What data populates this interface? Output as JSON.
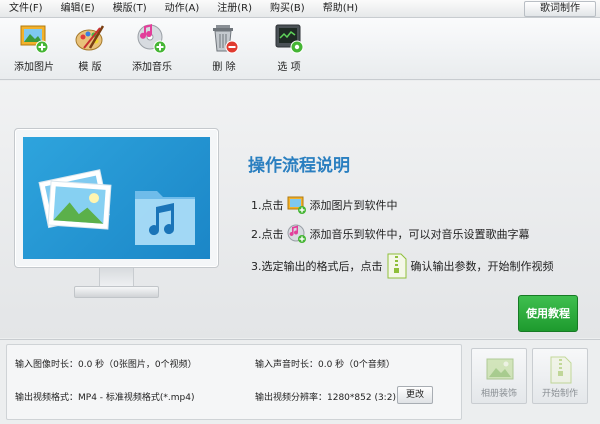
{
  "menu": {
    "items": [
      "文件(F)",
      "编辑(E)",
      "模版(T)",
      "动作(A)",
      "注册(R)",
      "购买(B)",
      "帮助(H)"
    ],
    "lyric_button": "歌词制作"
  },
  "toolbar": {
    "add_picture": "添加图片",
    "template": "模 版",
    "add_music": "添加音乐",
    "delete": "删 除",
    "options": "选 项"
  },
  "instructions": {
    "title": "操作流程说明",
    "step1_prefix": "1.点击",
    "step1_suffix": "添加图片到软件中",
    "step2_prefix": "2.点击",
    "step2_suffix": "添加音乐到软件中，可以对音乐设置歌曲字幕",
    "step3_prefix": "3.选定输出的格式后，点击",
    "step3_suffix": "确认输出参数，开始制作视频"
  },
  "tutorial_button": "使用教程",
  "info": {
    "image_duration": "输入图像时长：0.0 秒（0张图片，0个视频）",
    "audio_duration": "输入声音时长：0.0 秒（0个音频）",
    "output_format": "输出视频格式：MP4 - 标准视频格式(*.mp4)",
    "output_resolution": "输出视频分辨率：1280*852 (3:2)",
    "change_button": "更改"
  },
  "actions": {
    "album_decoration": "相册装饰",
    "start_production": "开始制作"
  },
  "colors": {
    "accent_blue": "#2a7fc0",
    "tutorial_green": "#1e9a2e",
    "screen_blue": "#1b86c7"
  }
}
